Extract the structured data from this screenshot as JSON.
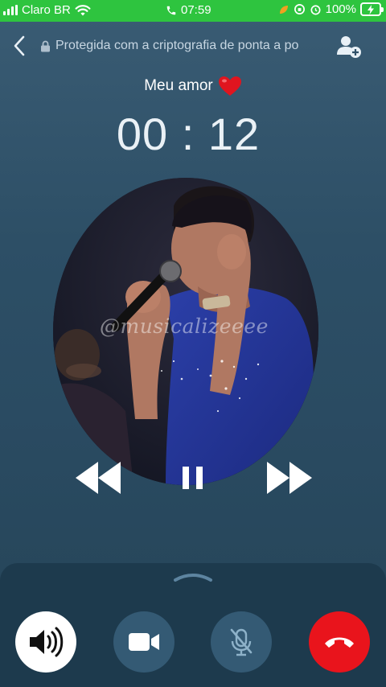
{
  "status_bar": {
    "carrier": "Claro BR",
    "time": "07:59",
    "battery": "100%",
    "background_color": "#2ec43f"
  },
  "header": {
    "back_icon": "chevron-left-icon",
    "encryption_text": "Protegida com a criptografia de ponta a po",
    "add_user_icon": "add-user-icon"
  },
  "call": {
    "contact_name": "Meu amor",
    "contact_emoji": "❤️",
    "duration": "00 : 12"
  },
  "video": {
    "watermark": "@musicalizeeee"
  },
  "media_controls": {
    "rewind_icon": "rewind-icon",
    "pause_icon": "pause-icon",
    "fast_forward_icon": "fast-forward-icon"
  },
  "actions": {
    "speaker_icon": "speaker-icon",
    "video_icon": "video-camera-icon",
    "mute_icon": "mic-off-icon",
    "end_call_icon": "end-call-icon",
    "end_call_color": "#e9141c"
  }
}
